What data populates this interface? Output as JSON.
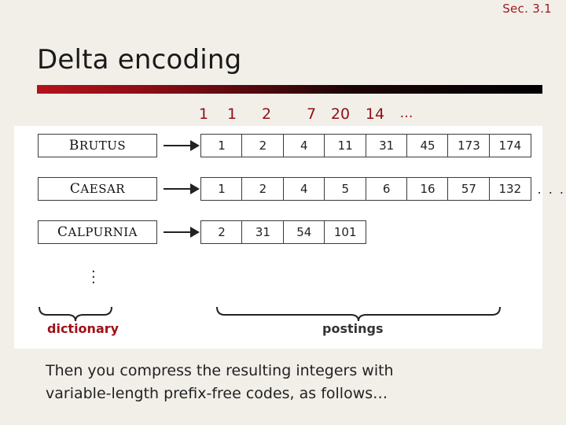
{
  "slide": {
    "section_label": "Sec. 3.1",
    "title": "Delta encoding",
    "accent_color": "#9b1b22",
    "gap_numbers": [
      "1",
      "1",
      "2",
      "7",
      "20",
      "14",
      "…"
    ],
    "rows": [
      {
        "term": "Brutus",
        "postings": [
          "1",
          "2",
          "4",
          "11",
          "31",
          "45",
          "173",
          "174"
        ],
        "trailing": ""
      },
      {
        "term": "Caesar",
        "postings": [
          "1",
          "2",
          "4",
          "5",
          "6",
          "16",
          "57",
          "132"
        ],
        "trailing": ". . ."
      },
      {
        "term": "Calpurnia",
        "postings": [
          "2",
          "31",
          "54",
          "101"
        ],
        "trailing": ""
      }
    ],
    "vertical_ellipsis": "⋮",
    "brace_labels": {
      "dictionary": "dictionary",
      "postings": "postings"
    },
    "caption_line1": "Then you compress the resulting integers with",
    "caption_line2": "variable-length prefix-free codes, as follows…"
  }
}
